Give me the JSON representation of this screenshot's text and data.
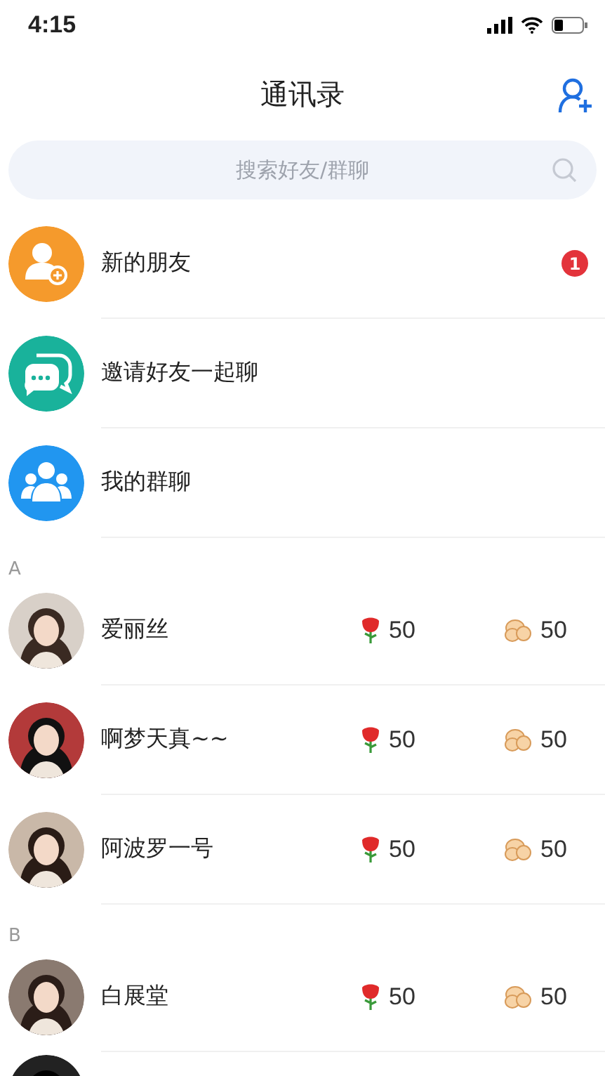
{
  "status_bar": {
    "time": "4:15"
  },
  "header": {
    "title": "通讯录"
  },
  "search": {
    "placeholder": "搜索好友/群聊"
  },
  "entries": [
    {
      "kind": "new-friends",
      "label": "新的朋友",
      "badge": "1"
    },
    {
      "kind": "invite",
      "label": "邀请好友一起聊"
    },
    {
      "kind": "groups",
      "label": "我的群聊"
    }
  ],
  "sections": [
    {
      "letter": "A",
      "contacts": [
        {
          "name": "爱丽丝",
          "roses": "50",
          "buns": "50",
          "kind": "picture"
        },
        {
          "name": "啊梦天真~~",
          "roses": "50",
          "buns": "50",
          "kind": "picture"
        },
        {
          "name": "阿波罗一号",
          "roses": "50",
          "buns": "50",
          "kind": "picture"
        }
      ]
    },
    {
      "letter": "B",
      "contacts": [
        {
          "name": "白展堂",
          "roses": "50",
          "buns": "50",
          "kind": "picture"
        }
      ]
    }
  ]
}
